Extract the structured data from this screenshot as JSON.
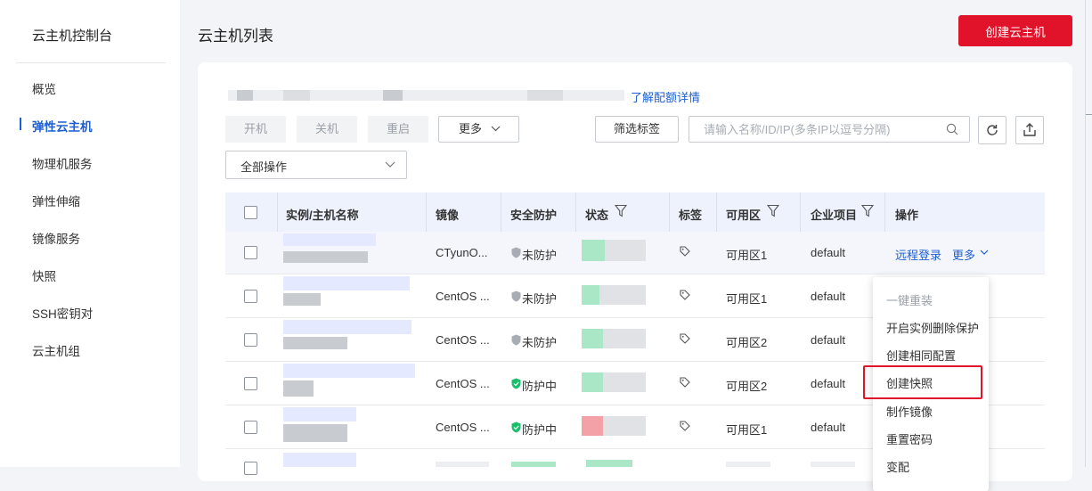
{
  "sidebar": {
    "title": "云主机控制台",
    "items": [
      {
        "label": "概览"
      },
      {
        "label": "弹性云主机"
      },
      {
        "label": "物理机服务"
      },
      {
        "label": "弹性伸缩"
      },
      {
        "label": "镜像服务"
      },
      {
        "label": "快照"
      },
      {
        "label": "SSH密钥对"
      },
      {
        "label": "云主机组"
      }
    ]
  },
  "header": {
    "title": "云主机列表",
    "create_button": "创建云主机"
  },
  "quota": {
    "link": "了解配额详情"
  },
  "toolbar": {
    "start": "开机",
    "stop": "关机",
    "restart": "重启",
    "more": "更多",
    "filter_tags": "筛选标签",
    "search_placeholder": "请输入名称/ID/IP(多条IP以逗号分隔)",
    "batch_select": "全部操作"
  },
  "table": {
    "columns": [
      "实例/主机名称",
      "镜像",
      "安全防护",
      "状态",
      "标签",
      "可用区",
      "企业项目",
      "操作"
    ],
    "rows": [
      {
        "image": "CTyunO...",
        "security": "未防护",
        "zone": "可用区1",
        "project": "default"
      },
      {
        "image": "CentOS ...",
        "security": "未防护",
        "zone": "可用区1",
        "project": "default"
      },
      {
        "image": "CentOS ...",
        "security": "未防护",
        "zone": "可用区2",
        "project": "default"
      },
      {
        "image": "CentOS ...",
        "security": "防护中",
        "zone": "可用区2",
        "project": "default"
      },
      {
        "image": "CentOS ...",
        "security": "防护中",
        "zone": "可用区1",
        "project": "default"
      }
    ],
    "actions": {
      "remote_login": "远程登录",
      "more": "更多"
    }
  },
  "dropdown_menu": {
    "items": [
      {
        "label": "一键重装",
        "disabled": true
      },
      {
        "label": "开启实例删除保护",
        "disabled": false
      },
      {
        "label": "创建相同配置",
        "disabled": false
      },
      {
        "label": "创建快照",
        "disabled": false,
        "highlighted": true
      },
      {
        "label": "制作镜像",
        "disabled": false
      },
      {
        "label": "重置密码",
        "disabled": false
      },
      {
        "label": "变配",
        "disabled": false
      }
    ]
  },
  "colors": {
    "accent": "#e0132a",
    "link": "#1d5fd1",
    "header_bg": "#edf2fd",
    "protected": "#19be6b",
    "unprotected": "#a8adb5"
  }
}
